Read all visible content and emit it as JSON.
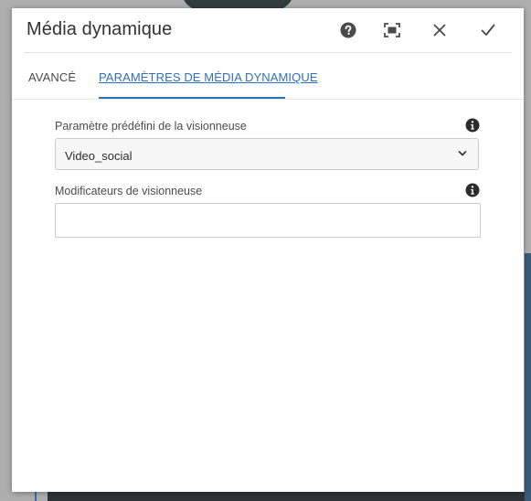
{
  "dialog": {
    "title": "Média dynamique"
  },
  "icons": {
    "help": "help-icon",
    "fullscreen": "fullscreen-icon",
    "close": "close-icon",
    "done": "checkmark-icon",
    "info": "info-icon",
    "chevron": "chevron-down-icon"
  },
  "tabs": [
    {
      "label": "AVANCÉ",
      "active": false
    },
    {
      "label": "PARAMÈTRES DE MÉDIA DYNAMIQUE",
      "active": true
    }
  ],
  "form": {
    "viewer_preset": {
      "label": "Paramètre prédéfini de la visionneuse",
      "value": "Video_social"
    },
    "viewer_modifiers": {
      "label": "Modificateurs de visionneuse",
      "value": ""
    }
  },
  "colors": {
    "accent": "#2f6fbf",
    "text": "#323232"
  }
}
